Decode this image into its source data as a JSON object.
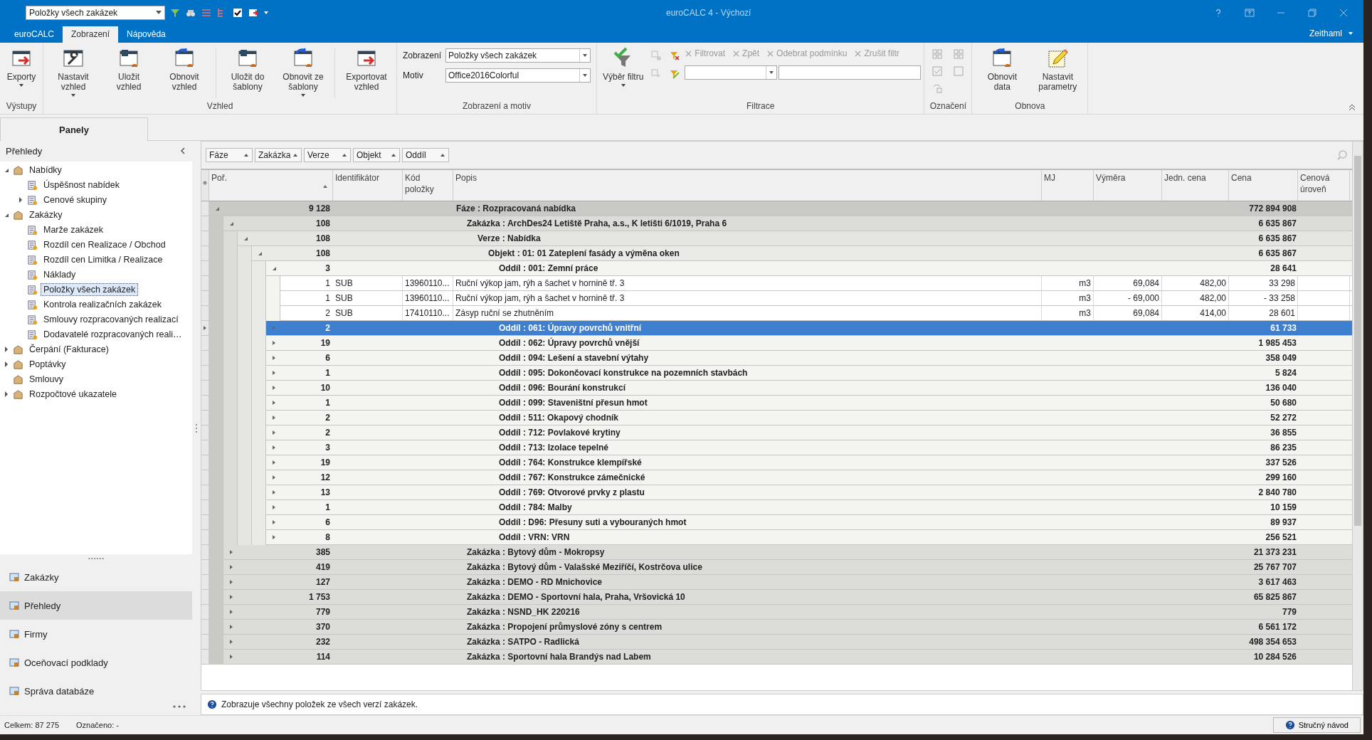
{
  "title_bar": {
    "quick_view": "Položky všech zakázek",
    "title": "euroCALC 4 - Výchozí"
  },
  "tabs": [
    {
      "label": "euroCALC",
      "selected": false
    },
    {
      "label": "Zobrazení",
      "selected": true
    },
    {
      "label": "Nápověda",
      "selected": false
    }
  ],
  "user": "Zeithaml",
  "ribbon": {
    "groups": [
      {
        "kind": "buttons",
        "label": "Výstupy",
        "items": [
          {
            "kind": "large",
            "label": "Exporty",
            "dropdown": true
          }
        ]
      },
      {
        "kind": "buttons",
        "label": "Vzhled",
        "items": [
          {
            "kind": "large",
            "label": "Nastavit vzhled",
            "dropdown": true
          },
          {
            "kind": "large",
            "label": "Uložit vzhled",
            "dropdown": false
          },
          {
            "kind": "large",
            "label": "Obnovit vzhled",
            "dropdown": false
          },
          {
            "kind": "separator"
          },
          {
            "kind": "large",
            "label": "Uložit do šablony",
            "dropdown": false
          },
          {
            "kind": "large",
            "label": "Obnovit ze šablony",
            "dropdown": true
          },
          {
            "kind": "separator"
          },
          {
            "kind": "large",
            "label": "Exportovat vzhled",
            "dropdown": false
          }
        ]
      },
      {
        "kind": "combos",
        "label": "Zobrazení a motiv",
        "items": [
          {
            "label": "Zobrazení",
            "value": "Položky všech zakázek"
          },
          {
            "label": "Motiv",
            "value": "Office2016Colorful"
          }
        ]
      },
      {
        "kind": "filter",
        "label": "Filtrace",
        "large": {
          "label": "Výběr filtru",
          "dropdown": true
        },
        "actions": [
          {
            "label": "Filtrovat",
            "disabled": true
          },
          {
            "label": "Zpět",
            "disabled": true
          },
          {
            "label": "Odebrat podmínku",
            "disabled": true
          },
          {
            "label": "Zrušit filtr",
            "disabled": true
          }
        ]
      },
      {
        "kind": "marks",
        "label": "Označení"
      },
      {
        "kind": "buttons",
        "label": "Obnova",
        "items": [
          {
            "kind": "large",
            "label": "Obnovit data",
            "dropdown": false
          },
          {
            "kind": "large",
            "label": "Nastavit parametry",
            "dropdown": false
          }
        ]
      }
    ]
  },
  "panels": {
    "tab": "Panely",
    "section": "Přehledy",
    "tree": [
      {
        "label": "Nabídky",
        "expanded": true,
        "selected": false,
        "children": [
          {
            "label": "Úspěšnost nabídek",
            "selected": false
          },
          {
            "label": "Cenové skupiny",
            "expanded": false,
            "selected": false
          }
        ]
      },
      {
        "label": "Zakázky",
        "expanded": true,
        "selected": false,
        "children": [
          {
            "label": "Marže zakázek",
            "selected": false
          },
          {
            "label": "Rozdíl cen Realizace / Obchod",
            "selected": false
          },
          {
            "label": "Rozdíl cen Limitka / Realizace",
            "selected": false
          },
          {
            "label": "Náklady",
            "selected": false
          },
          {
            "label": "Položky všech zakázek",
            "selected": true
          },
          {
            "label": "Kontrola realizačních zakázek",
            "selected": false
          },
          {
            "label": "Smlouvy rozpracovaných realizací",
            "selected": false
          },
          {
            "label": "Dodavatelé rozpracovaných reali…",
            "selected": false
          }
        ]
      },
      {
        "label": "Čerpání (Fakturace)",
        "expanded": false,
        "selected": false
      },
      {
        "label": "Poptávky",
        "expanded": false,
        "selected": false
      },
      {
        "label": "Smlouvy",
        "selected": false
      },
      {
        "label": "Rozpočtové ukazatele",
        "expanded": false,
        "selected": false
      }
    ],
    "nav": [
      {
        "label": "Zakázky",
        "selected": false
      },
      {
        "label": "Přehledy",
        "selected": true
      },
      {
        "label": "Firmy",
        "selected": false
      },
      {
        "label": "Oceňovací podklady",
        "selected": false
      },
      {
        "label": "Správa databáze",
        "selected": false
      }
    ]
  },
  "grid": {
    "group_by": [
      "Fáze",
      "Zakázka",
      "Verze",
      "Objekt",
      "Oddíl"
    ],
    "columns": [
      "Poř.",
      "Identifikátor",
      "Kód položky",
      "Popis",
      "MJ",
      "Výměra",
      "Jedn. cena",
      "Cena",
      "Cenová úroveň"
    ],
    "rows": [
      {
        "count": "9 128",
        "label": "Fáze : Rozpracovaná nabídka",
        "total": "772 894 908",
        "expanded": true,
        "selected": false,
        "children": [
          {
            "count": "108",
            "label": "Zakázka : ArchDes24 Letiště Praha, a.s., K letišti 6/1019, Praha 6",
            "total": "6 635 867",
            "expanded": true,
            "selected": false,
            "children": [
              {
                "count": "108",
                "label": "Verze : Nabídka",
                "total": "6 635 867",
                "expanded": true,
                "selected": false,
                "children": [
                  {
                    "count": "108",
                    "label": "Objekt : 01: 01 Zateplení fasády a výměna oken",
                    "total": "6 635 867",
                    "expanded": true,
                    "selected": false,
                    "children": [
                      {
                        "count": "3",
                        "label": "Oddíl : 001: Zemní práce",
                        "total": "28 641",
                        "expanded": true,
                        "selected": false,
                        "children": [
                          {
                            "kind": "item",
                            "selected": false,
                            "por": "1",
                            "id": "SUB",
                            "code": "13960110...",
                            "desc": "Ruční výkop jam, rýh a šachet v hornině tř. 3",
                            "mj": "m3",
                            "qty": "69,084",
                            "unit": "482,00",
                            "price": "33 298"
                          },
                          {
                            "kind": "item",
                            "selected": false,
                            "por": "1",
                            "id": "SUB",
                            "code": "13960110...",
                            "desc": "Ruční výkop jam, rýh a šachet v hornině tř. 3",
                            "mj": "m3",
                            "qty": "-  69,000",
                            "unit": "482,00",
                            "price": "-  33 258"
                          },
                          {
                            "kind": "item",
                            "selected": false,
                            "por": "2",
                            "id": "SUB",
                            "code": "17410110...",
                            "desc": "Zásyp ruční se zhutněním",
                            "mj": "m3",
                            "qty": "69,084",
                            "unit": "414,00",
                            "price": "28 601"
                          }
                        ]
                      },
                      {
                        "count": "2",
                        "label": "Oddíl : 061: Úpravy povrchů vnitřní",
                        "total": "61 733",
                        "expanded": false,
                        "selected": true
                      },
                      {
                        "count": "19",
                        "label": "Oddíl : 062: Úpravy povrchů vnější",
                        "total": "1 985 453",
                        "expanded": false,
                        "selected": false
                      },
                      {
                        "count": "6",
                        "label": "Oddíl : 094: Lešení a stavební výtahy",
                        "total": "358 049",
                        "expanded": false,
                        "selected": false
                      },
                      {
                        "count": "1",
                        "label": "Oddíl : 095: Dokončovací konstrukce na pozemních stavbách",
                        "total": "5 824",
                        "expanded": false,
                        "selected": false
                      },
                      {
                        "count": "10",
                        "label": "Oddíl : 096: Bourání konstrukcí",
                        "total": "136 040",
                        "expanded": false,
                        "selected": false
                      },
                      {
                        "count": "1",
                        "label": "Oddíl : 099: Staveništní přesun hmot",
                        "total": "50 680",
                        "expanded": false,
                        "selected": false
                      },
                      {
                        "count": "2",
                        "label": "Oddíl : 511: Okapový chodník",
                        "total": "52 272",
                        "expanded": false,
                        "selected": false
                      },
                      {
                        "count": "2",
                        "label": "Oddíl : 712: Povlakové krytiny",
                        "total": "36 855",
                        "expanded": false,
                        "selected": false
                      },
                      {
                        "count": "3",
                        "label": "Oddíl : 713: Izolace tepelné",
                        "total": "86 235",
                        "expanded": false,
                        "selected": false
                      },
                      {
                        "count": "19",
                        "label": "Oddíl : 764: Konstrukce klempířské",
                        "total": "337 526",
                        "expanded": false,
                        "selected": false
                      },
                      {
                        "count": "12",
                        "label": "Oddíl : 767: Konstrukce zámečnické",
                        "total": "299 160",
                        "expanded": false,
                        "selected": false
                      },
                      {
                        "count": "13",
                        "label": "Oddíl : 769: Otvorové prvky z plastu",
                        "total": "2 840 780",
                        "expanded": false,
                        "selected": false
                      },
                      {
                        "count": "1",
                        "label": "Oddíl : 784: Malby",
                        "total": "10 159",
                        "expanded": false,
                        "selected": false
                      },
                      {
                        "count": "6",
                        "label": "Oddíl : D96: Přesuny suti a vybouraných hmot",
                        "total": "89 937",
                        "expanded": false,
                        "selected": false
                      },
                      {
                        "count": "8",
                        "label": "Oddíl : VRN: VRN",
                        "total": "256 521",
                        "expanded": false,
                        "selected": false
                      }
                    ]
                  }
                ]
              }
            ]
          },
          {
            "count": "385",
            "label": "Zakázka : Bytový dům - Mokropsy",
            "total": "21 373 231",
            "expanded": false,
            "selected": false
          },
          {
            "count": "419",
            "label": "Zakázka : Bytový dům - Valašské Meziříčí, Kostrčova ulice",
            "total": "25 767 707",
            "expanded": false,
            "selected": false
          },
          {
            "count": "127",
            "label": "Zakázka : DEMO - RD Mnichovice",
            "total": "3 617 463",
            "expanded": false,
            "selected": false
          },
          {
            "count": "1 753",
            "label": "Zakázka : DEMO - Sportovní hala, Praha, Vršovická 10",
            "total": "65 825 867",
            "expanded": false,
            "selected": false
          },
          {
            "count": "779",
            "label": "Zakázka : NSND_HK 220216",
            "total": "779",
            "expanded": false,
            "selected": false
          },
          {
            "count": "370",
            "label": "Zakázka : Propojení průmyslové zóny s centrem",
            "total": "6 561 172",
            "expanded": false,
            "selected": false
          },
          {
            "count": "232",
            "label": "Zakázka : SATPO - Radlická",
            "total": "498 354 653",
            "expanded": false,
            "selected": false
          },
          {
            "count": "114",
            "label": "Zakázka : Sportovní hala Brandýs nad Labem",
            "total": "10 284 526",
            "expanded": false,
            "selected": false
          }
        ]
      }
    ]
  },
  "hint": "Zobrazuje všechny položek ze všech verzí zakázek.",
  "status": {
    "total": "Celkem: 87 275",
    "marked": "Označeno: -",
    "help": "Stručný návod"
  }
}
